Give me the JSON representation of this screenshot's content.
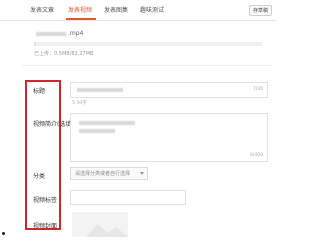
{
  "tabs": [
    {
      "label": "发表文章"
    },
    {
      "label": "发表视频"
    },
    {
      "label": "发表图集"
    },
    {
      "label": "趣味测试"
    }
  ],
  "draft_button": "存草稿",
  "upload": {
    "filename_suffix": ".mp4",
    "status": "已上传：0.5MB/82.27MB",
    "progress": 0.01
  },
  "form": {
    "title_label": "标题",
    "title_counter": "7/30",
    "title_limit_hint": "5-30字",
    "intro_label": "视频简介(选填)",
    "intro_counter": "0/400",
    "category_label": "分类",
    "category_placeholder": "请选择分类或者自行选择",
    "tags_label": "视频标签",
    "cover_label": "视频封面"
  },
  "colors": {
    "accent": "#e05a2a",
    "highlight": "#cc2a2a"
  }
}
